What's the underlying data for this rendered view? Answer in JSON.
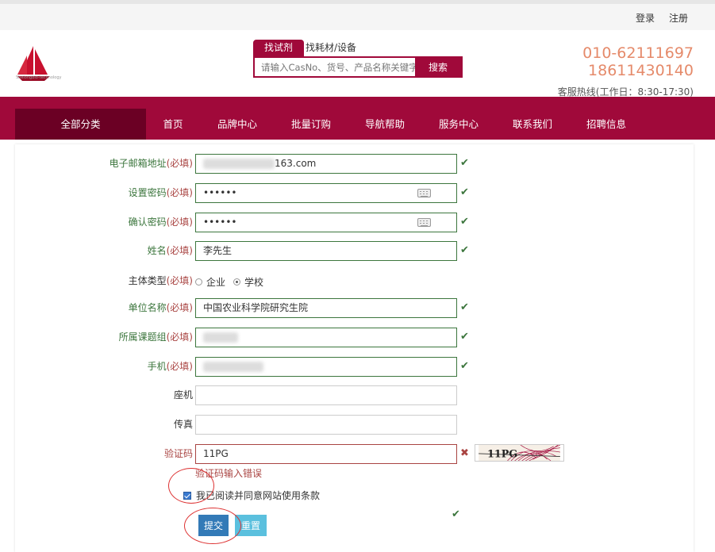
{
  "topbar": {
    "login": "登录",
    "register": "注册"
  },
  "header": {
    "logo_text": "Shelongbio-technology",
    "search_tabs": [
      "找试剂",
      "找耗材/设备"
    ],
    "search_placeholder": "请输入CasNo、货号、产品名称关键字",
    "search_button": "搜索",
    "phone1": "010-62111697",
    "phone2": "18611430140",
    "hotline": "客服热线(工作日：8:30-17:30)"
  },
  "nav": [
    "全部分类",
    "首页",
    "品牌中心",
    "批量订购",
    "导航帮助",
    "服务中心",
    "联系我们",
    "招聘信息"
  ],
  "form": {
    "required_mark": "(必填)",
    "email_label": "电子邮箱地址",
    "email_value_suffix": "163.com",
    "password_label": "设置密码",
    "password_value": "••••••",
    "confirm_label": "确认密码",
    "confirm_value": "••••••",
    "name_label": "姓名",
    "name_value": "李先生",
    "type_label": "主体类型",
    "type_options": [
      "企业",
      "学校"
    ],
    "type_selected": "学校",
    "org_label": "单位名称",
    "org_value": "中国农业科学院研究生院",
    "group_label": "所属课题组",
    "mobile_label": "手机",
    "landline_label": "座机",
    "fax_label": "传真",
    "captcha_label": "验证码",
    "captcha_value": "11PG",
    "captcha_image_text": "11PG",
    "captcha_error": "验证码输入错误",
    "agree_text": "我已阅读并同意网站使用条款",
    "submit": "提交",
    "reset": "重置"
  },
  "colors": {
    "brand": "#a0093a",
    "brand_dark": "#6b0024",
    "success": "#3c763d",
    "error": "#a94442",
    "phone": "#e58a6a"
  }
}
